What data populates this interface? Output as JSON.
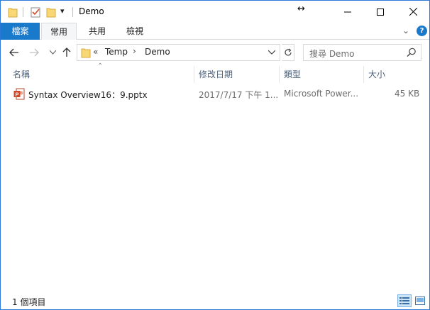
{
  "window": {
    "title": "Demo",
    "resize_glyph": "↔",
    "controls": {
      "minimize_icon": "minimize-icon",
      "maximize_icon": "maximize-icon",
      "close_icon": "close-icon"
    }
  },
  "quick_access": {
    "icons": [
      "folder-icon",
      "properties-check-icon",
      "new-folder-icon",
      "customize-dropdown-icon"
    ],
    "dropdown_glyph": "▾"
  },
  "ribbon": {
    "tabs": [
      {
        "label": "檔案"
      },
      {
        "label": "常用"
      },
      {
        "label": "共用"
      },
      {
        "label": "檢視"
      }
    ],
    "active_tab": "常用",
    "expand_glyph": "⌄",
    "help_glyph": "?"
  },
  "navigation": {
    "back_icon": "back-arrow-icon",
    "forward_icon": "forward-arrow-icon",
    "recent_icon": "recent-locations-icon",
    "up_icon": "up-arrow-icon"
  },
  "address": {
    "overflow_glyph": "«",
    "crumbs": [
      "Temp",
      "Demo"
    ],
    "separator": "›"
  },
  "search": {
    "placeholder": "搜尋 Demo"
  },
  "columns": {
    "name": "名稱",
    "date_modified": "修改日期",
    "type": "類型",
    "size": "大小"
  },
  "files": [
    {
      "name": "Syntax Overview16：9.pptx",
      "date_modified": "2017/7/17 下午 1...",
      "type": "Microsoft Power...",
      "size": "45 KB",
      "icon": "powerpoint-file-icon"
    }
  ],
  "status": {
    "item_count": "1 個項目"
  },
  "colors": {
    "accent": "#1979ca",
    "border": "#2b79d8",
    "header_text": "#4c607a",
    "muted_text": "#6d6d6d",
    "folder_yellow": "#f8d775",
    "powerpoint_red": "#d24726"
  }
}
